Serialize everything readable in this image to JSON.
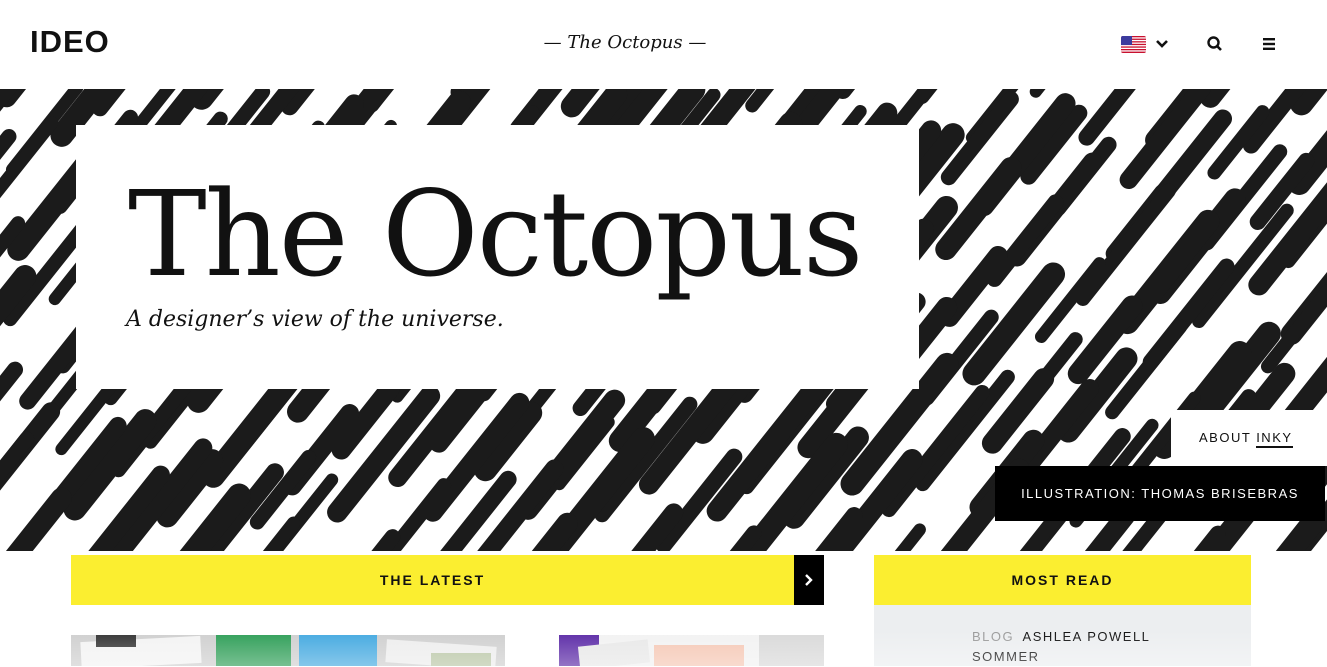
{
  "header": {
    "logo": "IDEO",
    "title": "— The Octopus —",
    "flag_icon": "us-flag-icon",
    "dropdown_icon": "chevron-down-icon",
    "search_icon": "search-icon",
    "menu_icon": "hamburger-menu-icon"
  },
  "hero": {
    "title": "The Octopus",
    "tagline": "A designer’s view of the universe.",
    "about_prefix": "ABOUT",
    "about_link": "INKY",
    "credit": "ILLUSTRATION: THOMAS BRISEBRAS"
  },
  "latest": {
    "label": "THE LATEST",
    "arrow_icon": "chevron-right-icon"
  },
  "most_read": {
    "label": "MOST READ",
    "items": [
      {
        "category": "BLOG",
        "title": "ASHLEA POWELL SOMMER"
      }
    ]
  },
  "colors": {
    "accent_yellow": "#fbee30",
    "ink": "#111111",
    "panel_gray": "#eceef0"
  }
}
